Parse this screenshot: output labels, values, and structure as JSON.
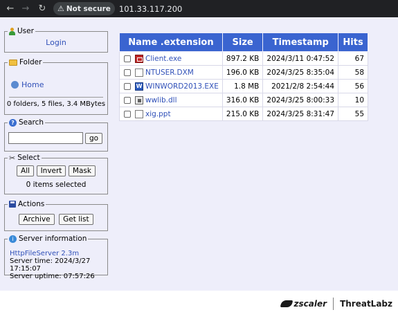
{
  "browser": {
    "security_label": "Not secure",
    "url": "101.33.117.200"
  },
  "sidebar": {
    "user": {
      "title": "User",
      "login": "Login"
    },
    "folder": {
      "title": "Folder",
      "home": "Home",
      "summary": "0 folders, 5 files, 3.4 MBytes"
    },
    "search": {
      "title": "Search",
      "query": "",
      "go": "go"
    },
    "select": {
      "title": "Select",
      "all": "All",
      "invert": "Invert",
      "mask": "Mask",
      "status": "0 items selected"
    },
    "actions": {
      "title": "Actions",
      "archive": "Archive",
      "get_list": "Get list"
    },
    "server": {
      "title": "Server information",
      "software": "HttpFileServer 2.3m",
      "time": "Server time: 2024/3/27 17:15:07",
      "uptime": "Server uptime: 07:57:26"
    }
  },
  "table": {
    "headers": [
      "Name .extension",
      "Size",
      "Timestamp",
      "Hits"
    ],
    "rows": [
      {
        "icon": "exe-icon",
        "name": "Client.exe",
        "size": "897.2 KB",
        "timestamp": "2024/3/11 0:47:52",
        "hits": "67"
      },
      {
        "icon": "blank-file-icon",
        "name": "NTUSER.DXM",
        "size": "196.0 KB",
        "timestamp": "2024/3/25 8:35:04",
        "hits": "58"
      },
      {
        "icon": "word-icon",
        "name": "WINWORD2013.EXE",
        "size": "1.8 MB",
        "timestamp": "2021/2/8 2:54:44",
        "hits": "56"
      },
      {
        "icon": "dll-icon",
        "name": "wwlib.dll",
        "size": "316.0 KB",
        "timestamp": "2024/3/25 8:00:33",
        "hits": "10"
      },
      {
        "icon": "blank-file-icon",
        "name": "xig.ppt",
        "size": "215.0 KB",
        "timestamp": "2024/3/25 8:31:47",
        "hits": "55"
      }
    ]
  },
  "footer": {
    "brand_left": "zscaler",
    "brand_right": "ThreatLabz"
  },
  "colors": {
    "header_blue": "#3a64d0",
    "page_bg": "#eeeefa",
    "link": "#3050b8"
  }
}
